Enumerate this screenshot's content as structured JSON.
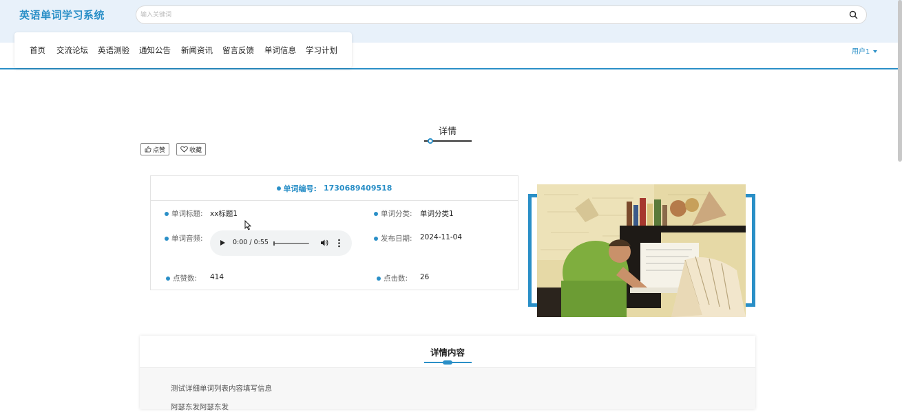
{
  "header": {
    "logo": "英语单词学习系统",
    "search_placeholder": "输入关键词",
    "nav": [
      "首页",
      "交流论坛",
      "英语测验",
      "通知公告",
      "新闻资讯",
      "留言反馈",
      "单词信息",
      "学习计划"
    ],
    "user": "用户1"
  },
  "section": {
    "title": "详情"
  },
  "actions": {
    "like": "点赞",
    "favorite": "收藏"
  },
  "info": {
    "id_label": "单词编号:",
    "id_value": "1730689409518",
    "title_label": "单词标题:",
    "title_value": "xx标题1",
    "category_label": "单词分类:",
    "category_value": "单词分类1",
    "audio_label": "单词音频:",
    "audio_time": "0:00 / 0:55",
    "audio_progress": 0,
    "date_label": "发布日期:",
    "date_value": "2024-11-04",
    "likes_label": "点赞数:",
    "likes_value": "414",
    "clicks_label": "点击数:",
    "clicks_value": "26"
  },
  "detail": {
    "title": "详情内容",
    "lines": [
      "测试详细单词列表内容填写信息",
      "阿瑟东发阿瑟东发"
    ]
  },
  "colors": {
    "accent": "#2a8fc7",
    "topbar": "#e8f1fa"
  }
}
